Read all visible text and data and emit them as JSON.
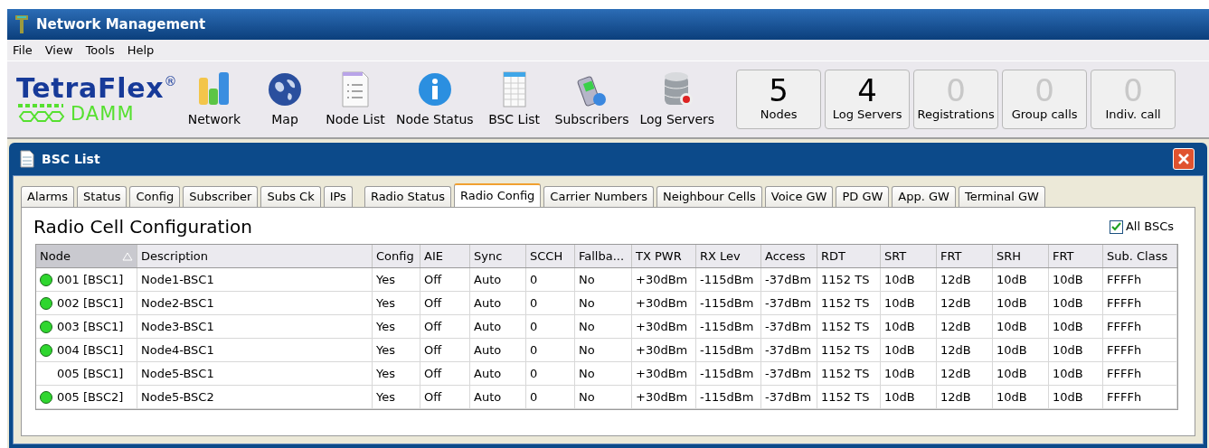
{
  "window": {
    "title": "Network Management"
  },
  "menu": [
    "File",
    "View",
    "Tools",
    "Help"
  ],
  "logo": {
    "brand": "TetraFlex",
    "mark": "®",
    "maker": "DAMM"
  },
  "toolbar": [
    {
      "label": "Network",
      "kind": "bars"
    },
    {
      "label": "Map",
      "kind": "globe"
    },
    {
      "label": "Node List",
      "kind": "list"
    },
    {
      "label": "Node Status",
      "kind": "info"
    },
    {
      "label": "BSC List",
      "kind": "sheet"
    },
    {
      "label": "Subscribers",
      "kind": "phone"
    },
    {
      "label": "Log Servers",
      "kind": "db"
    }
  ],
  "counters": [
    {
      "value": "5",
      "label": "Nodes",
      "active": true
    },
    {
      "value": "4",
      "label": "Log Servers",
      "active": true
    },
    {
      "value": "0",
      "label": "Registrations",
      "active": false
    },
    {
      "value": "0",
      "label": "Group calls",
      "active": false
    },
    {
      "value": "0",
      "label": "Indiv. call",
      "active": false
    }
  ],
  "child_window": {
    "title": "BSC List"
  },
  "tabs": [
    {
      "label": "Alarms",
      "selected": false
    },
    {
      "label": "Status",
      "selected": false
    },
    {
      "label": "Config",
      "selected": false
    },
    {
      "label": "Subscriber",
      "selected": false
    },
    {
      "label": "Subs Ck",
      "selected": false
    },
    {
      "label": "IPs",
      "selected": false
    },
    {
      "label": "Radio Status",
      "selected": false
    },
    {
      "label": "Radio Config",
      "selected": true
    },
    {
      "label": "Carrier Numbers",
      "selected": false
    },
    {
      "label": "Neighbour Cells",
      "selected": false
    },
    {
      "label": "Voice GW",
      "selected": false
    },
    {
      "label": "PD GW",
      "selected": false
    },
    {
      "label": "App. GW",
      "selected": false
    },
    {
      "label": "Terminal GW",
      "selected": false
    }
  ],
  "heading": "Radio Cell Configuration",
  "all_bscs": {
    "label": "All BSCs",
    "checked": true
  },
  "table": {
    "columns": [
      "Node",
      "Description",
      "Config",
      "AIE",
      "Sync",
      "SCCH",
      "Fallba...",
      "TX PWR",
      "RX Lev",
      "Access",
      "RDT",
      "SRT",
      "FRT",
      "SRH",
      "FRT",
      "Sub. Class"
    ],
    "rows": [
      {
        "online": true,
        "cells": [
          "001 [BSC1]",
          "Node1-BSC1",
          "Yes",
          "Off",
          "Auto",
          "0",
          "No",
          "+30dBm",
          "-115dBm",
          "-37dBm",
          "1152 TS",
          "10dB",
          "12dB",
          "10dB",
          "10dB",
          "FFFFh"
        ]
      },
      {
        "online": true,
        "cells": [
          "002 [BSC1]",
          "Node2-BSC1",
          "Yes",
          "Off",
          "Auto",
          "0",
          "No",
          "+30dBm",
          "-115dBm",
          "-37dBm",
          "1152 TS",
          "10dB",
          "12dB",
          "10dB",
          "10dB",
          "FFFFh"
        ]
      },
      {
        "online": true,
        "cells": [
          "003 [BSC1]",
          "Node3-BSC1",
          "Yes",
          "Off",
          "Auto",
          "0",
          "No",
          "+30dBm",
          "-115dBm",
          "-37dBm",
          "1152 TS",
          "10dB",
          "12dB",
          "10dB",
          "10dB",
          "FFFFh"
        ]
      },
      {
        "online": true,
        "cells": [
          "004 [BSC1]",
          "Node4-BSC1",
          "Yes",
          "Off",
          "Auto",
          "0",
          "No",
          "+30dBm",
          "-115dBm",
          "-37dBm",
          "1152 TS",
          "10dB",
          "12dB",
          "10dB",
          "10dB",
          "FFFFh"
        ]
      },
      {
        "online": false,
        "cells": [
          "005 [BSC1]",
          "Node5-BSC1",
          "Yes",
          "Off",
          "Auto",
          "0",
          "No",
          "+30dBm",
          "-115dBm",
          "-37dBm",
          "1152 TS",
          "10dB",
          "12dB",
          "10dB",
          "10dB",
          "FFFFh"
        ]
      },
      {
        "online": true,
        "cells": [
          "005 [BSC2]",
          "Node5-BSC2",
          "Yes",
          "Off",
          "Auto",
          "0",
          "No",
          "+30dBm",
          "-115dBm",
          "-37dBm",
          "1152 TS",
          "10dB",
          "12dB",
          "10dB",
          "10dB",
          "FFFFh"
        ]
      }
    ]
  }
}
